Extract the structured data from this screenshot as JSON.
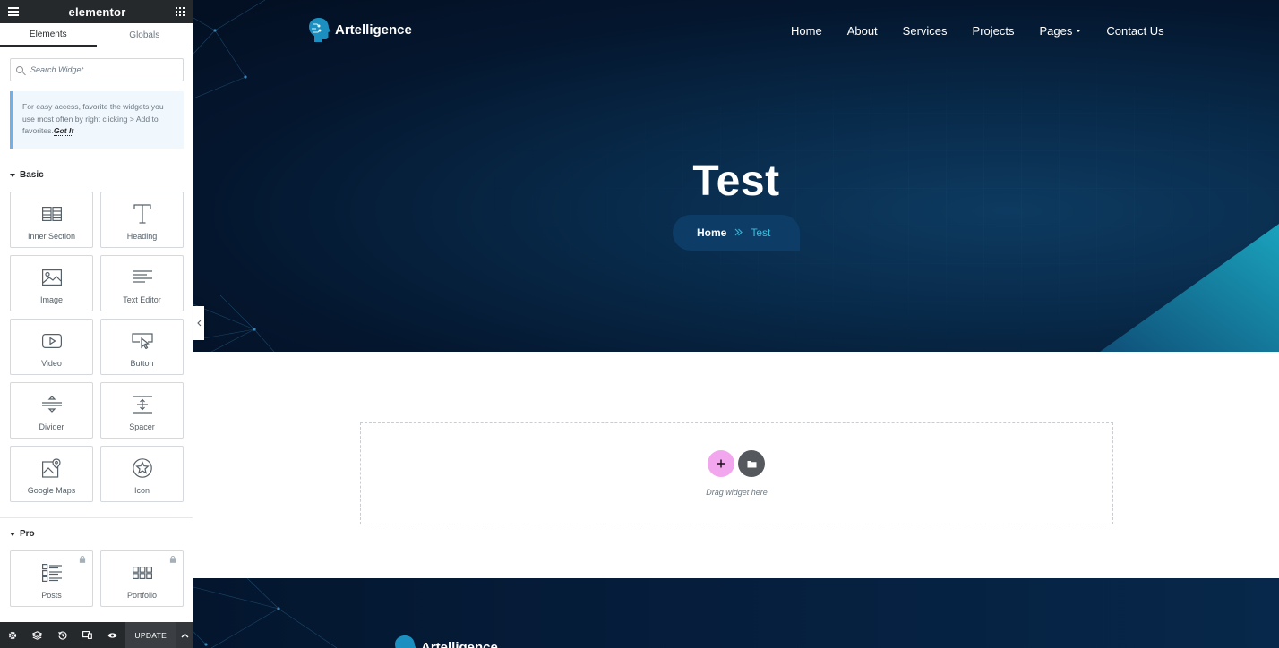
{
  "editor": {
    "brand": "elementor",
    "tabs": [
      {
        "label": "Elements"
      },
      {
        "label": "Globals"
      }
    ],
    "search_placeholder": "Search Widget...",
    "tip": {
      "text": "For easy access, favorite the widgets you use most often by right clicking > Add to favorites.",
      "action": "Got It"
    },
    "sections": {
      "basic": "Basic",
      "pro": "Pro"
    },
    "basic_widgets": [
      {
        "label": "Inner Section",
        "icon": "inner-section-icon"
      },
      {
        "label": "Heading",
        "icon": "heading-icon"
      },
      {
        "label": "Image",
        "icon": "image-icon"
      },
      {
        "label": "Text Editor",
        "icon": "text-editor-icon"
      },
      {
        "label": "Video",
        "icon": "video-icon"
      },
      {
        "label": "Button",
        "icon": "button-icon"
      },
      {
        "label": "Divider",
        "icon": "divider-icon"
      },
      {
        "label": "Spacer",
        "icon": "spacer-icon"
      },
      {
        "label": "Google Maps",
        "icon": "google-maps-icon"
      },
      {
        "label": "Icon",
        "icon": "star-icon"
      }
    ],
    "pro_widgets": [
      {
        "label": "Posts",
        "icon": "posts-icon",
        "locked": true
      },
      {
        "label": "Portfolio",
        "icon": "portfolio-icon",
        "locked": true
      }
    ],
    "footer": {
      "update_label": "UPDATE"
    }
  },
  "site": {
    "logo_text": "Artelligence",
    "nav": [
      {
        "label": "Home"
      },
      {
        "label": "About"
      },
      {
        "label": "Services"
      },
      {
        "label": "Projects"
      },
      {
        "label": "Pages",
        "dropdown": true
      },
      {
        "label": "Contact Us"
      }
    ],
    "hero_title": "Test",
    "breadcrumb": {
      "home": "Home",
      "current": "Test"
    },
    "dropzone_text": "Drag widget here",
    "colors": {
      "hero_dark": "#04162e",
      "accent_cyan": "#39c1e1",
      "add_button": "#f2a6ee",
      "editor_dark": "#26292c"
    }
  }
}
